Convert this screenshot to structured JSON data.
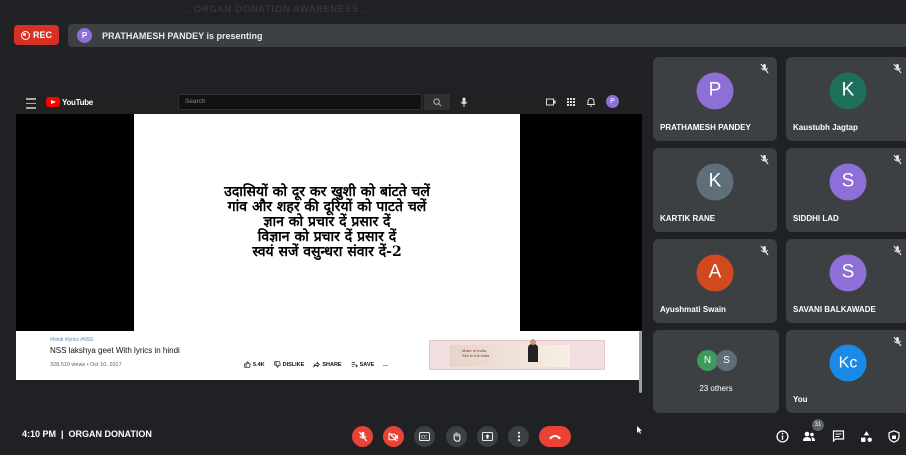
{
  "window": {
    "ghost_title": "... ORGAN DONATION AWARENESS ..."
  },
  "recording": {
    "label": "REC",
    "color": "#d93025"
  },
  "presenter": {
    "initial": "P",
    "banner": "PRATHAMESH PANDEY is presenting"
  },
  "youtube": {
    "logo_text": "YouTube",
    "search_placeholder": "Search",
    "avatar_initial": "P"
  },
  "slide": {
    "lines": [
      "उदासियों को दूर कर खुशी को बांटते चलें",
      "गांव और शहर की दूरियों को पाटते चलें",
      "ज्ञान को प्रचार दें प्रसार दें",
      "विज्ञान को प्रचार दें प्रसार दें",
      "स्वयं सजें वसुन्धरा संवार दें-2"
    ]
  },
  "video_info": {
    "meta": "#hindi #lyrics #NSS",
    "title": "NSS lakshya geet With lyrics in hindi",
    "views": "328,510 views • Oct 10, 2017",
    "likes": "5.4K",
    "dislike_label": "DISLIKE",
    "share_label": "SHARE",
    "save_label": "SAVE",
    "more_label": "...",
    "ad_text_1": "Make in India,",
    "ad_text_2": "Sell to full India"
  },
  "participants": [
    {
      "initial": "P",
      "name": "PRATHAMESH PANDEY",
      "color": "#8e6fd8"
    },
    {
      "initial": "K",
      "name": "Kaustubh Jagtap",
      "color": "#1e6f5c"
    },
    {
      "initial": "K",
      "name": "KARTIK RANE",
      "color": "#5f6f7a"
    },
    {
      "initial": "S",
      "name": "SIDDHI LAD",
      "color": "#8e6fd8"
    },
    {
      "initial": "A",
      "name": "Ayushmati Swain",
      "color": "#d2491f"
    },
    {
      "initial": "S",
      "name": "SAVANI BALKAWADE",
      "color": "#8e6fd8"
    }
  ],
  "others": {
    "initials": [
      "N",
      "S"
    ],
    "label": "23 others"
  },
  "self": {
    "initials": "Kc",
    "name": "You",
    "color": "#1a8ae6"
  },
  "bottom_bar": {
    "time": "4:10 PM",
    "separator": "|",
    "meeting_name": "ORGAN DONATION",
    "participants_count": "31"
  }
}
